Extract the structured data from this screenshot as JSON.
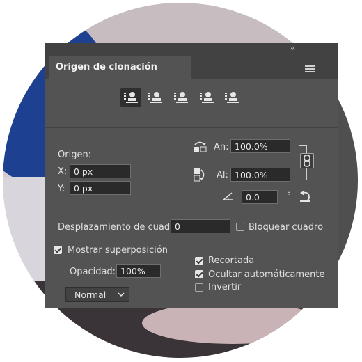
{
  "panel": {
    "title": "Origen de clonación",
    "collapse_glyph": "«",
    "menu_icon": "panel-menu-icon",
    "source_buttons": [
      {
        "name": "clone-source-1-icon",
        "active": true
      },
      {
        "name": "clone-source-2-icon",
        "active": false
      },
      {
        "name": "clone-source-3-icon",
        "active": false
      },
      {
        "name": "clone-source-4-icon",
        "active": false
      },
      {
        "name": "clone-source-5-icon",
        "active": false
      }
    ]
  },
  "origin": {
    "label": "Origen:",
    "x_label": "X:",
    "x_value": "0 px",
    "y_label": "Y:",
    "y_value": "0 px"
  },
  "scale": {
    "width_label": "An:",
    "width_value": "100.0%",
    "height_label": "Al:",
    "height_value": "100.0%",
    "angle_value": "0.0",
    "angle_unit": "°"
  },
  "offset": {
    "label": "Desplazamiento de cuadro:",
    "value": "0",
    "lock_label": "Bloquear cuadro",
    "lock_checked": false
  },
  "overlay": {
    "show_label": "Mostrar superposición",
    "show_checked": true,
    "opacity_label": "Opacidad:",
    "opacity_value": "100%",
    "blend_mode": "Normal",
    "clipped_label": "Recortada",
    "clipped_checked": true,
    "autohide_label": "Ocultar automáticamente",
    "autohide_checked": true,
    "invert_label": "Invertir",
    "invert_checked": false
  },
  "colors": {
    "panel_bg": "#535353",
    "tab_bar_bg": "#424242",
    "field_bg": "#2a2a2a",
    "text": "#e6e6e6",
    "background_fabric": "#1b3f8f"
  }
}
